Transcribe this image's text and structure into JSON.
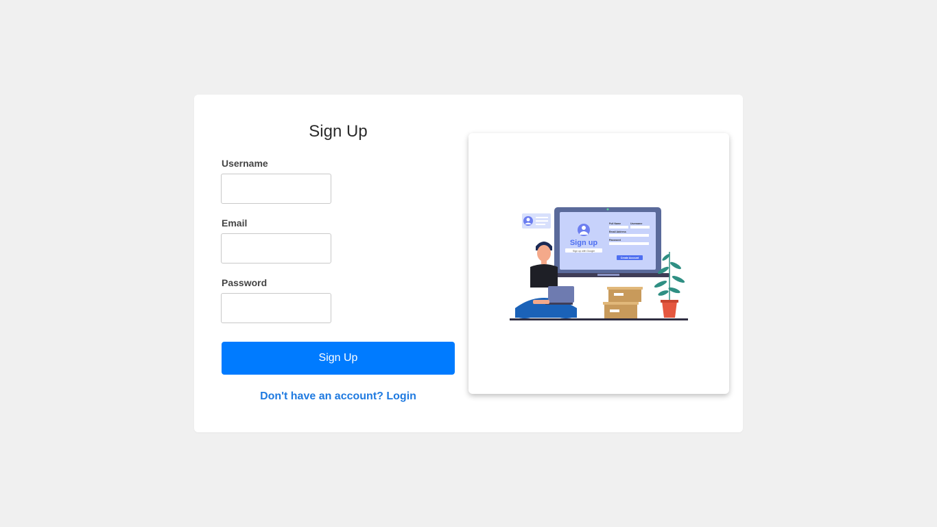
{
  "form": {
    "title": "Sign Up",
    "fields": [
      {
        "label": "Username",
        "value": "",
        "placeholder": ""
      },
      {
        "label": "Email",
        "value": "",
        "placeholder": ""
      },
      {
        "label": "Password",
        "value": "",
        "placeholder": ""
      }
    ],
    "submit_label": "Sign Up",
    "login_link": "Don't have an account? Login"
  },
  "illustration": {
    "screen_heading": "Sign up",
    "google_button": "Sign up with Google",
    "field_labels": [
      "Full Name",
      "Username",
      "Email Address",
      "Password"
    ],
    "create_button": "Create Account",
    "icons": [
      "person-avatar-icon",
      "plant-icon",
      "boxes-icon"
    ]
  },
  "colors": {
    "background": "#f0f0f0",
    "primary": "#007bff",
    "link": "#1f7ae0"
  }
}
